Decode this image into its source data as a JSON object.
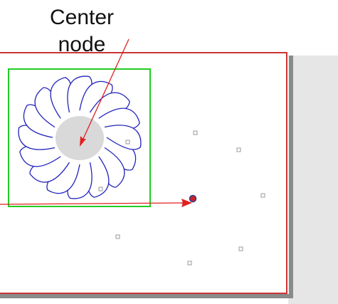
{
  "annotation": {
    "label": "Center\nnode"
  },
  "colors": {
    "canvas_border": "#cc3333",
    "canvas_bg": "#ffffff",
    "outer_gray": "#e6e6e6",
    "shadow": "#8a8a8a",
    "bounding_box": "#22cc22",
    "feather_stroke": "#2222bb",
    "center_fill": "#d9d9d9",
    "arrow": "#e02020",
    "selected_node_fill": "#cc2222",
    "selected_node_stroke": "#2a3a99",
    "node_marker": "#888888"
  },
  "icons": {
    "feather_wreath": "feather-wreath-icon",
    "node_marker": "node-marker-icon",
    "selected_node": "selected-node-icon"
  }
}
